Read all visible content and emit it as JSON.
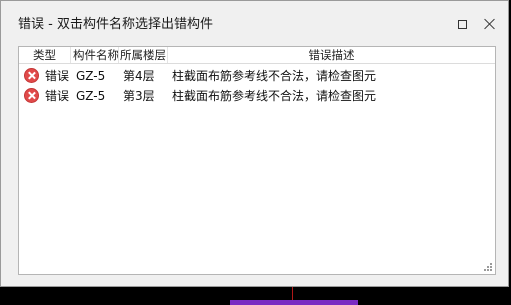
{
  "dialog": {
    "title": "错误 - 双击构件名称选择出错构件"
  },
  "list": {
    "columns": {
      "type": "类型",
      "name": "构件名称",
      "floor": "所属楼层",
      "description": "错误描述"
    },
    "rows": [
      {
        "icon": "error-icon",
        "type": "错误",
        "name": "GZ-5",
        "floor": "第4层",
        "description": "柱截面布筋参考线不合法，请检查图元"
      },
      {
        "icon": "error-icon",
        "type": "错误",
        "name": "GZ-5",
        "floor": "第3层",
        "description": "柱截面布筋参考线不合法，请检查图元"
      }
    ]
  },
  "colors": {
    "error": "#e04a4a",
    "window_bg": "#f0f0f0",
    "list_bg": "#ffffff"
  },
  "icons": {
    "maximize": "maximize-icon",
    "close": "close-icon",
    "error": "error-icon"
  }
}
